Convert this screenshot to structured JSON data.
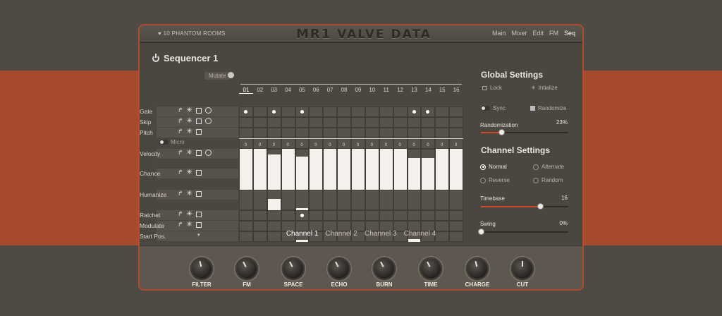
{
  "header": {
    "brand": "♥ 10 PHANTOM ROOMS",
    "logo_a": "MR1",
    "logo_b": "VALVE DATA",
    "nav": [
      "Main",
      "Mixer",
      "Edit",
      "FM",
      "Seq"
    ],
    "nav_active": "Seq"
  },
  "sequencer": {
    "title": "Sequencer 1",
    "mutate": "Mutate",
    "micro": "Micro",
    "rows": [
      "Gate",
      "Skip",
      "Pitch",
      "Velocity",
      "Chance",
      "Humanize",
      "Ratchet",
      "Modulate",
      "Start Pos."
    ],
    "steps": [
      "01",
      "02",
      "03",
      "04",
      "05",
      "06",
      "07",
      "08",
      "09",
      "10",
      "11",
      "12",
      "13",
      "14",
      "15",
      "16"
    ],
    "active_step": "01",
    "gate_steps": [
      1,
      3,
      5,
      13,
      14
    ],
    "pitch_values": [
      "0",
      "0",
      "0",
      "0",
      "0",
      "0",
      "0",
      "0",
      "0",
      "0",
      "0",
      "0",
      "0",
      "0",
      "0",
      "0"
    ],
    "velocity_levels": [
      1.0,
      1.0,
      0.72,
      1.0,
      0.6,
      1.0,
      1.0,
      1.0,
      1.0,
      1.0,
      1.0,
      1.0,
      0.55,
      0.55,
      1.0,
      1.0
    ],
    "chance_levels": [
      1.0,
      1.0,
      1.0,
      1.0,
      1.0,
      1.0,
      1.0,
      1.0,
      1.0,
      1.0,
      1.0,
      1.0,
      1.0,
      1.0,
      1.0,
      1.0
    ],
    "humanize_levels": [
      0,
      0,
      0.55,
      0,
      0.1,
      0,
      0,
      0,
      0,
      0,
      0,
      0,
      0,
      0,
      0,
      0
    ],
    "ratchet_steps": [
      5
    ],
    "start_pos_levels": [
      0,
      0,
      0,
      0,
      0.3,
      0,
      0,
      0,
      0,
      0,
      0,
      0,
      0.4,
      0,
      0,
      0
    ]
  },
  "global_settings": {
    "title": "Global Settings",
    "lock": "Lock",
    "initialize": "Intialize",
    "sync": "Sync",
    "randomize": "Randomize",
    "randomization_label": "Randomization",
    "randomization_value": "23%",
    "randomization_level": 0.23
  },
  "channel_settings": {
    "title": "Channel Settings",
    "modes": [
      "Normal",
      "Alternate",
      "Reverse",
      "Random"
    ],
    "mode_selected": "Normal",
    "timebase_label": "Timebase",
    "timebase_value": "16",
    "timebase_level": 0.68,
    "swing_label": "Swing",
    "swing_value": "0%",
    "swing_level": 0.0
  },
  "channel_tabs": [
    "Channel 1",
    "Channel 2",
    "Channel 3",
    "Channel 4"
  ],
  "channel_active": "Channel 1",
  "knobs": [
    "FILTER",
    "FM",
    "SPACE",
    "ECHO",
    "BURN",
    "TIME",
    "CHARGE",
    "CUT"
  ],
  "knob_levels": [
    0.45,
    0.4,
    0.4,
    0.4,
    0.4,
    0.4,
    0.45,
    0.5
  ],
  "colors": {
    "accent": "#d44a28",
    "background_band": "#a84a2e"
  }
}
